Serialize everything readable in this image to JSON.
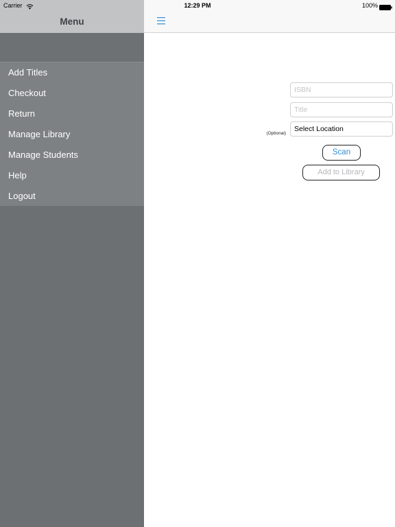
{
  "status_bar": {
    "carrier": "Carrier",
    "time": "12:29 PM",
    "battery": "100%",
    "wifi_icon": "wifi-icon",
    "battery_icon": "battery-icon"
  },
  "sidebar": {
    "title": "Menu",
    "items": [
      {
        "label": "Add Titles"
      },
      {
        "label": "Checkout"
      },
      {
        "label": "Return"
      },
      {
        "label": "Manage Library"
      },
      {
        "label": "Manage Students"
      },
      {
        "label": "Help"
      },
      {
        "label": "Logout"
      }
    ]
  },
  "nav": {
    "menu_icon": "hamburger-icon"
  },
  "form": {
    "isbn": {
      "value": "",
      "placeholder": "ISBN"
    },
    "title": {
      "value": "",
      "placeholder": "Title"
    },
    "location": {
      "value": "Select Location",
      "note": "(Optional)"
    },
    "scan_label": "Scan",
    "add_label": "Add to Library"
  },
  "colors": {
    "accent": "#2f8ed8",
    "sidebar_bg": "#6c7073",
    "sidebar_menu_bg": "#7d8184",
    "sidebar_header_bg": "#c2c3c4",
    "disabled_text": "#b7b7bb"
  }
}
